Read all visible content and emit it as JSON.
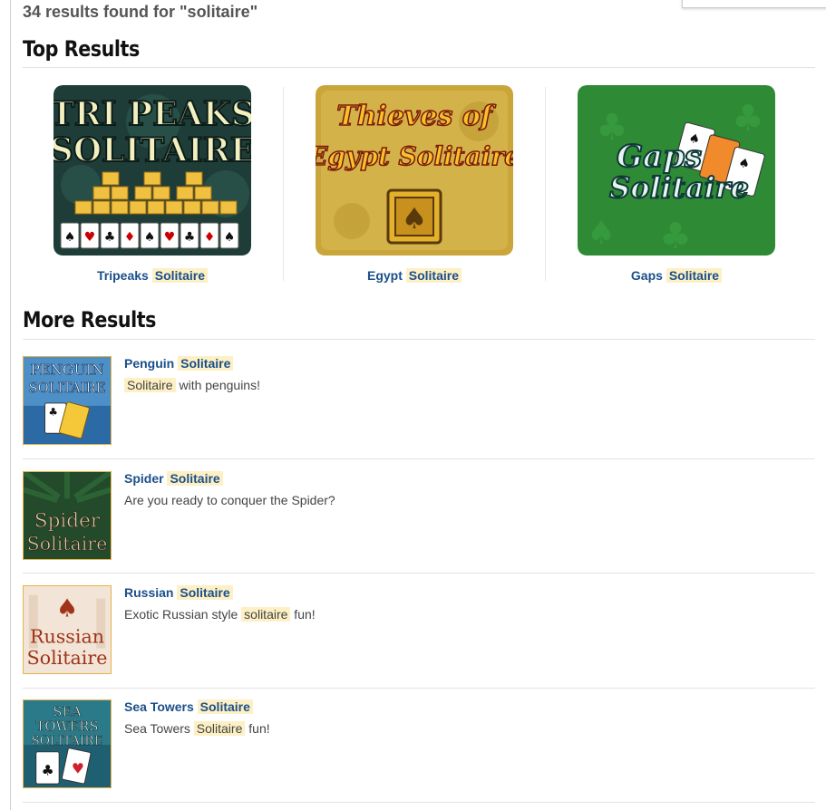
{
  "search": {
    "results_count_text": "34 results found for \"solitaire\""
  },
  "sections": {
    "top_results_title": "Top Results",
    "more_results_title": "More Results"
  },
  "top_results": [
    {
      "name": "Tripeaks",
      "highlight": "Solitaire",
      "thumb_lines": [
        "TRI PEAKS",
        "SOLITAIRE"
      ]
    },
    {
      "name": "Egypt",
      "highlight": "Solitaire",
      "thumb_lines": [
        "Thieves of",
        "Egypt Solitaire"
      ]
    },
    {
      "name": "Gaps",
      "highlight": "Solitaire",
      "thumb_lines": [
        "Gaps",
        "Solitaire"
      ]
    }
  ],
  "more_results": [
    {
      "name": "Penguin",
      "highlight": "Solitaire",
      "desc_before": "",
      "desc_highlight": "Solitaire",
      "desc_after": " with penguins!",
      "thumb_lines": [
        "PENGUIN",
        "SOLITAIRE"
      ]
    },
    {
      "name": "Spider",
      "highlight": "Solitaire",
      "desc_before": "Are you ready to conquer the Spider?",
      "desc_highlight": "",
      "desc_after": "",
      "thumb_lines": [
        "Spider",
        "Solitaire"
      ]
    },
    {
      "name": "Russian",
      "highlight": "Solitaire",
      "desc_before": "Exotic Russian style ",
      "desc_highlight": "solitaire",
      "desc_after": " fun!",
      "thumb_lines": [
        "Russian",
        "Solitaire"
      ]
    },
    {
      "name": "Sea Towers",
      "highlight": "Solitaire",
      "desc_before": "Sea Towers ",
      "desc_highlight": "Solitaire",
      "desc_after": " fun!",
      "thumb_lines": [
        "SEA",
        "TOWERS",
        "SOLITAIRE"
      ]
    }
  ],
  "colors": {
    "link": "#1b4f8a",
    "highlight_bg": "#fdf0c4"
  }
}
